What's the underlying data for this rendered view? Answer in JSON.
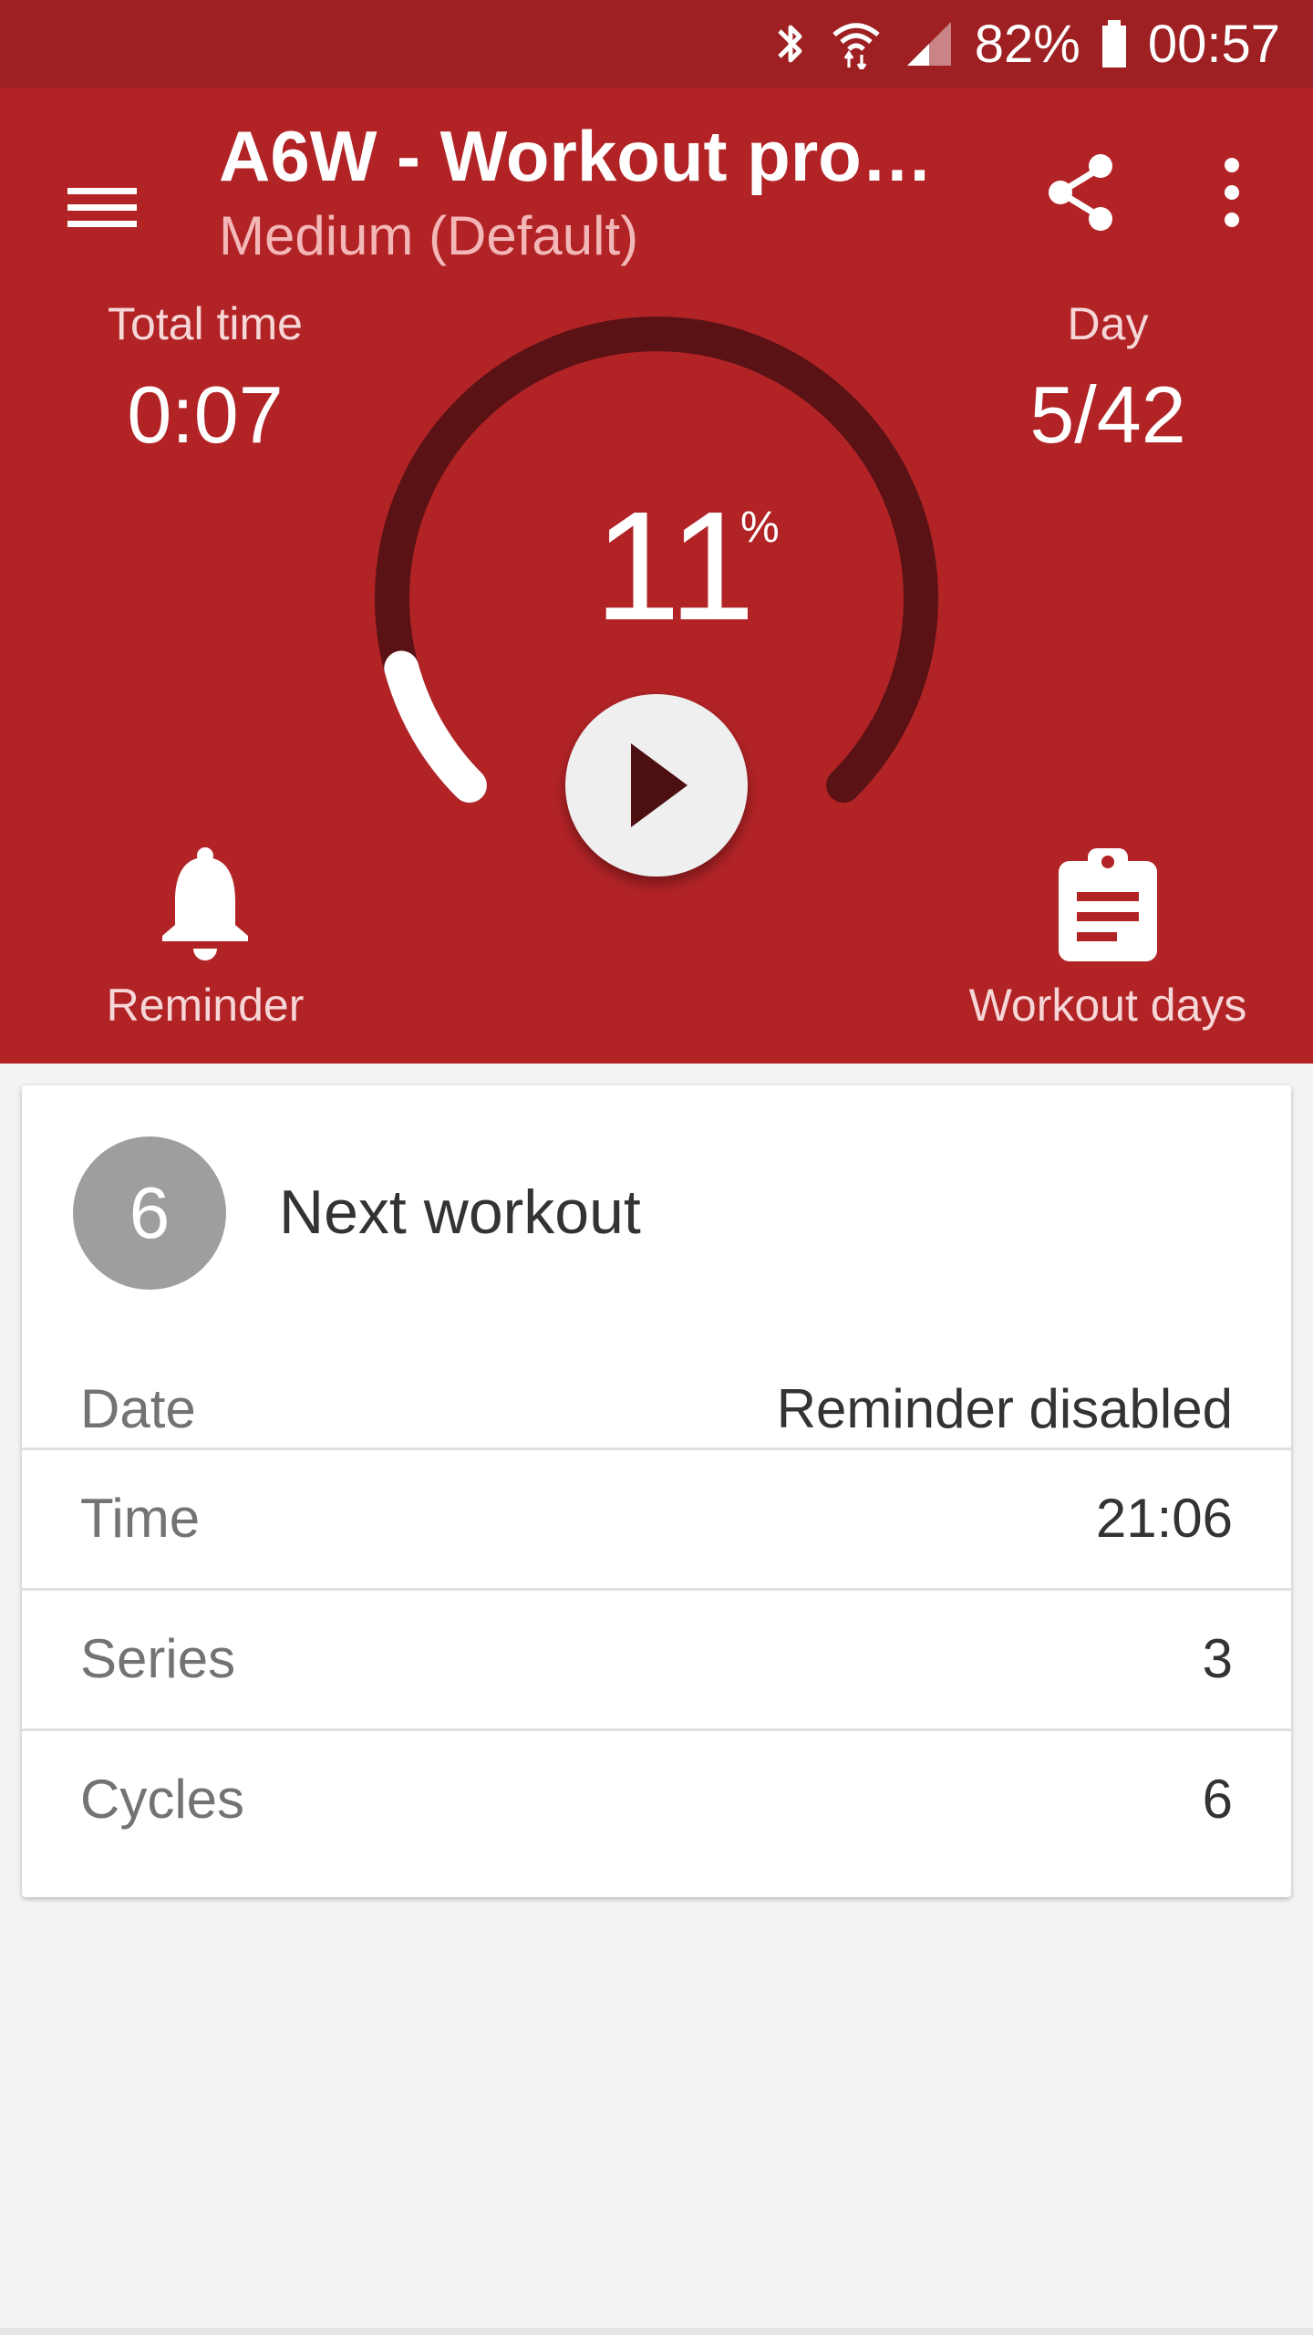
{
  "status_bar": {
    "battery": "82%",
    "time": "00:57",
    "icons": [
      "bluetooth-icon",
      "wifi-icon",
      "signal-icon",
      "battery-icon"
    ]
  },
  "app_bar": {
    "title": "A6W - Workout progr...",
    "subtitle": "Medium (Default)",
    "icons": [
      "menu-icon",
      "share-icon",
      "more-vert-icon"
    ]
  },
  "stats": {
    "total_time_label": "Total time",
    "total_time_value": "0:07",
    "day_label": "Day",
    "day_value": "5/42"
  },
  "progress": {
    "percent_value": "11",
    "percent_sign": "%",
    "fraction": 0.11
  },
  "actions": {
    "reminder_label": "Reminder",
    "workout_days_label": "Workout days"
  },
  "next_workout": {
    "day_number": "6",
    "title": "Next workout",
    "rows": [
      {
        "label": "Date",
        "value": "Reminder disabled"
      },
      {
        "label": "Time",
        "value": "21:06"
      },
      {
        "label": "Series",
        "value": "3"
      },
      {
        "label": "Cycles",
        "value": "6"
      }
    ]
  },
  "colors": {
    "primary": "#b22326",
    "status_bar": "#9e2022",
    "gauge_track": "#5a1214",
    "gauge_fill": "#ffffff"
  }
}
